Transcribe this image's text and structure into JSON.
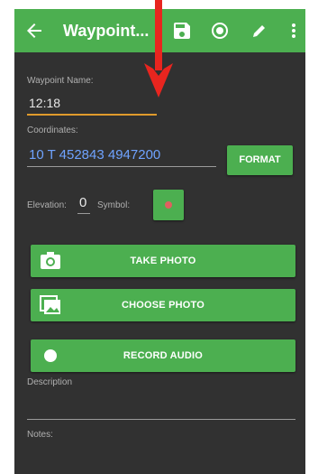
{
  "toolbar": {
    "back_icon": "arrow-left-icon",
    "title": "Waypoint...",
    "icons": [
      "save-icon",
      "radio-target-icon",
      "edit-pencil-icon",
      "more-vert-icon"
    ]
  },
  "form": {
    "waypoint_name_label": "Waypoint Name:",
    "waypoint_name_value": "12:18",
    "coordinates_label": "Coordinates:",
    "coordinates_value": "10 T 452843 4947200",
    "format_button": "FORMAT",
    "elevation_label": "Elevation:",
    "elevation_value": "0",
    "symbol_label": "Symbol:",
    "symbol_color": "#e06060"
  },
  "buttons": {
    "take_photo": "TAKE PHOTO",
    "choose_photo": "CHOOSE PHOTO",
    "record_audio": "RECORD AUDIO"
  },
  "fields": {
    "description_label": "Description",
    "notes_label": "Notes:"
  },
  "colors": {
    "accent": "#4caf50",
    "background": "#313131",
    "cursor_underline": "#e09a2c",
    "annotation_arrow": "#e8251f"
  }
}
